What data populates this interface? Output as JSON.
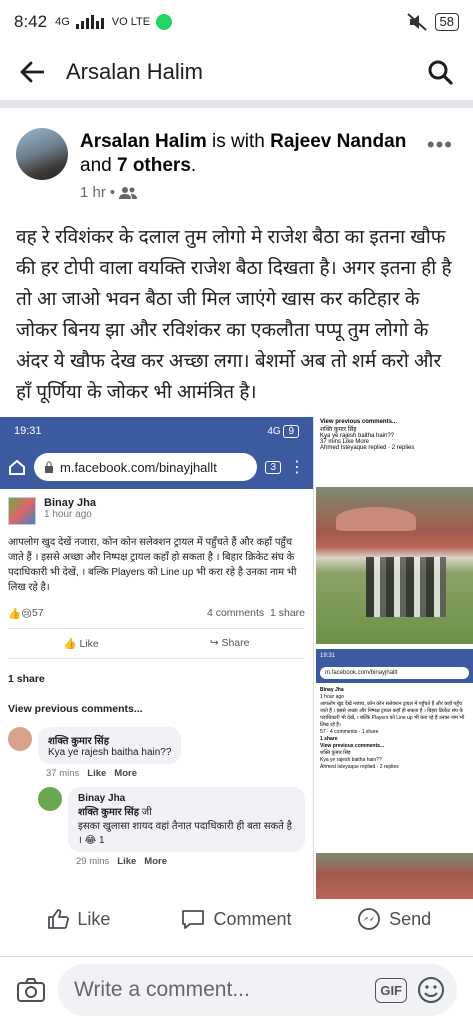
{
  "status_bar": {
    "time": "8:42",
    "network": "4G",
    "volte": "VO LTE",
    "battery": "58"
  },
  "header": {
    "title": "Arsalan Halim"
  },
  "post": {
    "author": "Arsalan Halim",
    "with_text": "is with",
    "tagged": "Rajeev Nandan",
    "and_text": "and",
    "others": "7 others",
    "period": ".",
    "time": "1 hr",
    "body": "वह रे रविशंकर के दलाल तुम लोगो मे राजेश बैठा का इतना खौफ की हर टोपी वाला वयक्ति राजेश बैठा दिखता है। अगर इतना ही है तो आ जाओ भवन बैठा जी मिल जाएंगे खास कर कटिहार के जोकर बिनय झा और रविशंकर का एकलौता पप्पू तुम लोगो के अंदर ये खौफ देख कर अच्छा लगा। बेशर्मो अब तो शर्म करो और हाँ पूर्णिया के जोकर भी आमंत्रित है।"
  },
  "screenshot": {
    "time": "19:31",
    "signal": "4G",
    "tabs": "9",
    "url": "m.facebook.com/binayjhallt",
    "url_tabs": "3",
    "author": "Binay Jha",
    "time_ago": "1 hour ago",
    "text": "आपलोग खुद देखें नजारा, कोन कोन सलेक्शन ट्रायल में पहुँचते हैं और कहाँ पहुँच जाते हैं । इससे अच्छा और निष्पक्ष ट्रायल कहाँ हो सकता है । बिहार क्रिकेट संघ के पदाधिकारी भी देखें, । बल्कि Players को Line up भी करा रहे है उनका नाम भी लिख रहे है।",
    "reactions": "57",
    "comments": "4 comments",
    "shares_count": "1 share",
    "like": "Like",
    "share": "Share",
    "shares_label": "1 share",
    "view_prev": "View previous comments...",
    "c1_name": "शक्ति कुमार सिंह",
    "c1_text": "Kya ye rajesh baitha hain??",
    "c1_time": "37 mins",
    "c_like": "Like",
    "c_more": "More",
    "r_name": "Binay Jha",
    "r_tag": "शक्ति कुमार सिंह",
    "r_ji": "जी",
    "r_text": "इसका खुलासा शायद वहां तैनात पदाधिकारी ही बता सकते है ।",
    "r_react": "1",
    "r_time": "29 mins"
  },
  "side_top": {
    "view_prev": "View previous comments...",
    "name": "शक्ति कुमार सिंह",
    "text": "Kya ye rajesh baitha hain??",
    "meta": "37 mins  Like  More",
    "reply": "Ahmed Isteyaque replied · 2 replies"
  },
  "actions": {
    "like": "Like",
    "comment": "Comment",
    "send": "Send"
  },
  "composer": {
    "placeholder": "Write a comment...",
    "gif": "GIF"
  },
  "colors": {
    "fb_blue": "#3b5aa0",
    "text_secondary": "#65676b"
  }
}
